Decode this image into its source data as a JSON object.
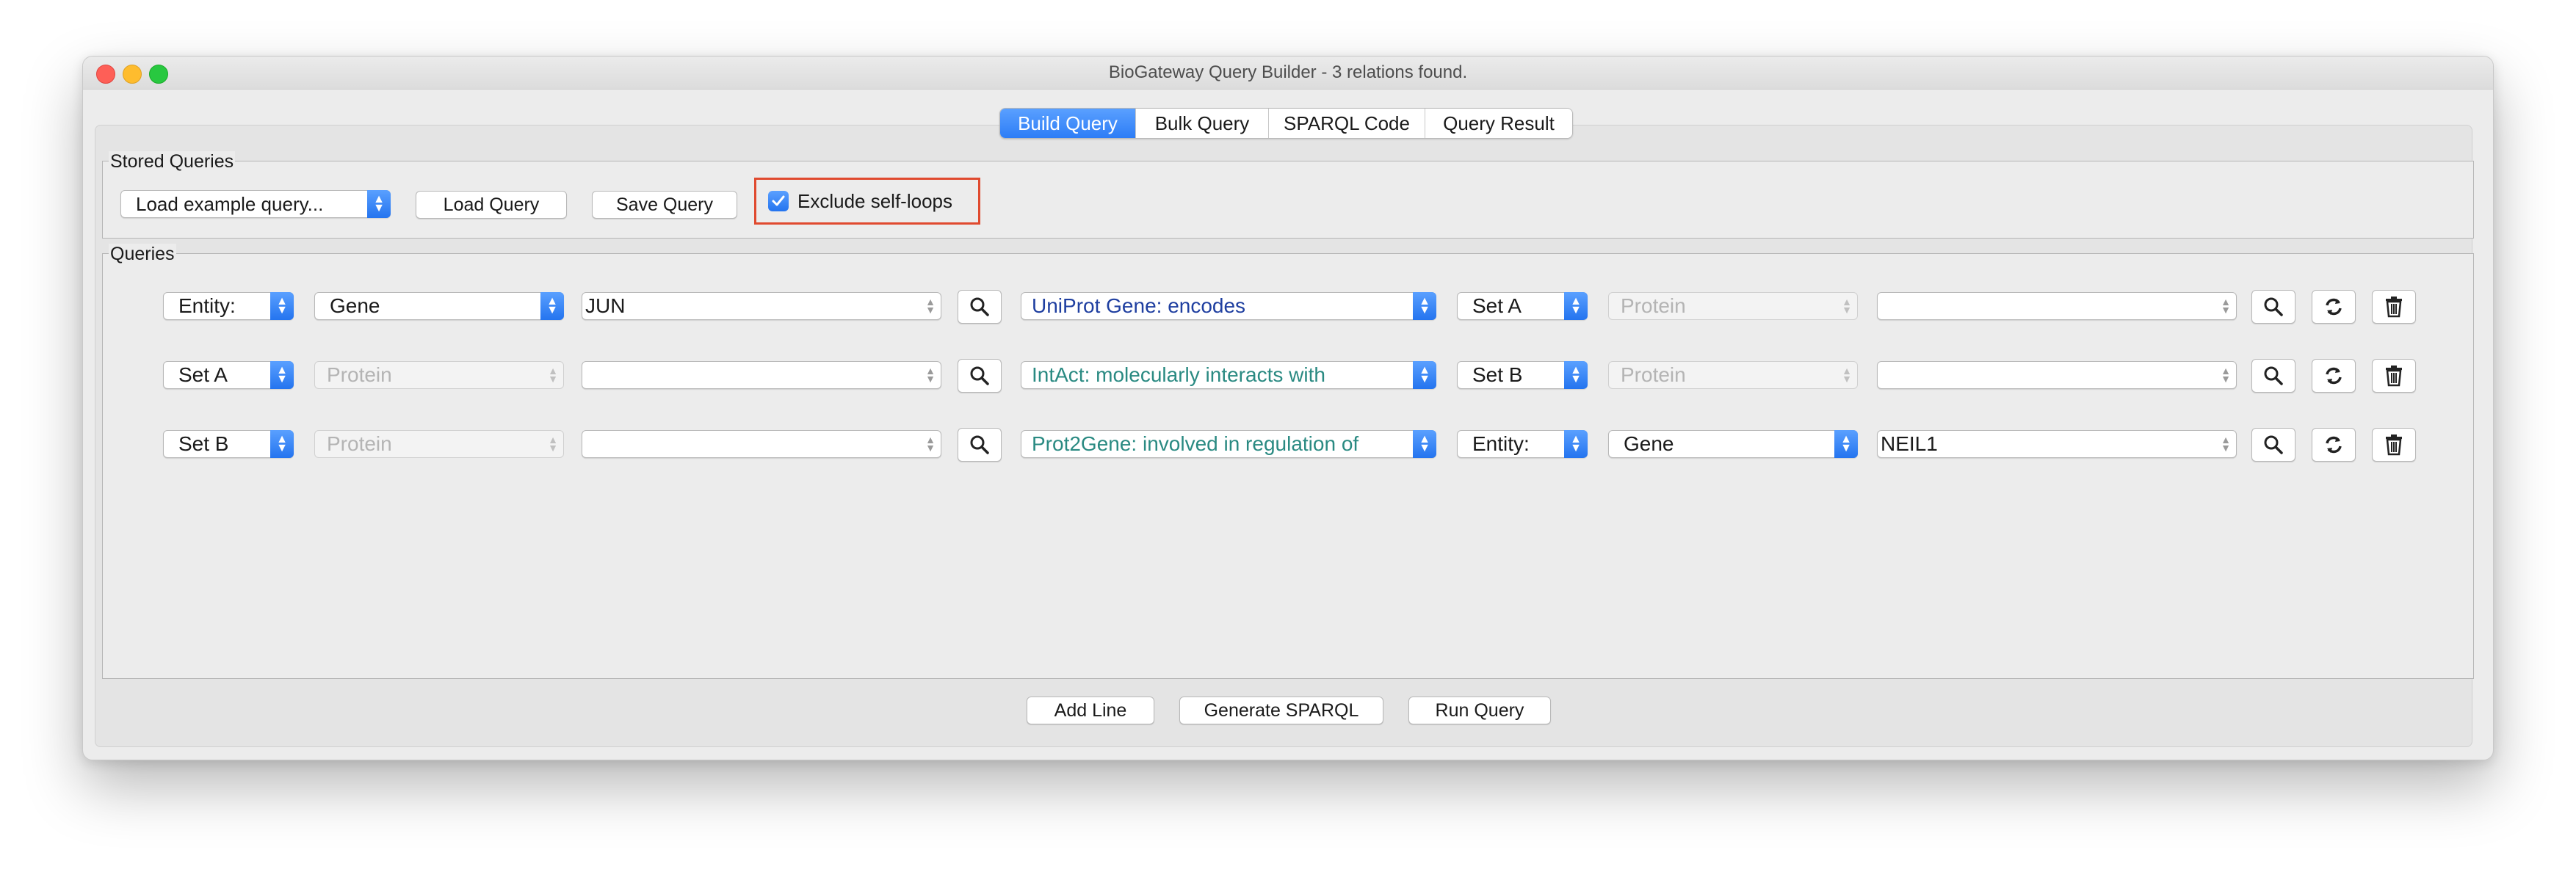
{
  "window": {
    "title": "BioGateway Query Builder - 3 relations found."
  },
  "tabs": [
    {
      "label": "Build Query",
      "active": true
    },
    {
      "label": "Bulk Query",
      "active": false
    },
    {
      "label": "SPARQL Code",
      "active": false
    },
    {
      "label": "Query Result",
      "active": false
    }
  ],
  "stored_queries": {
    "title": "Stored Queries",
    "example_select": "Load example query...",
    "load_button": "Load Query",
    "save_button": "Save Query",
    "exclude_self_loops": {
      "label": "Exclude self-loops",
      "checked": true
    }
  },
  "queries": {
    "title": "Queries",
    "rows": [
      {
        "subject_type": "Entity:",
        "subject_class": "Gene",
        "subject_value": "JUN",
        "relation": "UniProt Gene: encodes",
        "object_type": "Set A",
        "object_class": "Protein",
        "object_value": ""
      },
      {
        "subject_type": "Set A",
        "subject_class": "Protein",
        "subject_value": "",
        "relation": "IntAct: molecularly interacts with",
        "object_type": "Set B",
        "object_class": "Protein",
        "object_value": ""
      },
      {
        "subject_type": "Set B",
        "subject_class": "Protein",
        "subject_value": "",
        "relation": "Prot2Gene: involved in regulation of",
        "object_type": "Entity:",
        "object_class": "Gene",
        "object_value": "NEIL1"
      }
    ]
  },
  "footer": {
    "add_line": "Add Line",
    "generate_sparql": "Generate SPARQL",
    "run_query": "Run Query"
  },
  "colors": {
    "accent": "#2d7df6",
    "highlight_border": "#e04a2f",
    "relation_navy": "#1f3fa0",
    "relation_teal": "#2a8a82"
  }
}
